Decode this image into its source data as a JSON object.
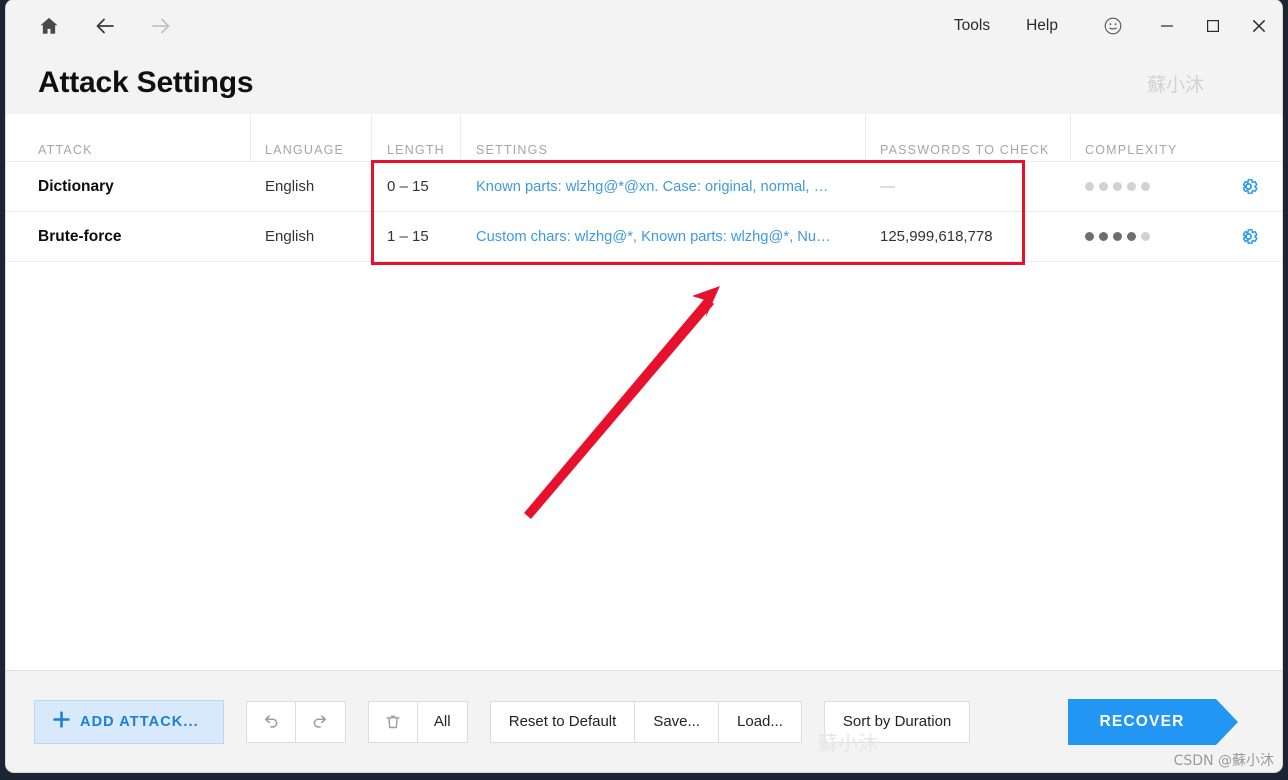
{
  "titlebar": {
    "nav": [
      {
        "name": "home-icon",
        "label": "Home"
      },
      {
        "name": "back-icon",
        "label": "Back"
      },
      {
        "name": "forward-icon",
        "label": "Forward"
      }
    ],
    "menus": [
      {
        "label": "Tools"
      },
      {
        "label": "Help"
      }
    ],
    "smiley_title": "Feedback",
    "window_controls": {
      "minimize": "—",
      "maximize": "□",
      "close": "✕"
    }
  },
  "header": {
    "title": "Attack Settings",
    "watermark": "蘇小沐"
  },
  "table": {
    "columns": [
      {
        "key": "attack",
        "label": "ATTACK"
      },
      {
        "key": "language",
        "label": "LANGUAGE"
      },
      {
        "key": "length",
        "label": "LENGTH"
      },
      {
        "key": "settings",
        "label": "SETTINGS"
      },
      {
        "key": "passwords",
        "label": "PASSWORDS TO CHECK"
      },
      {
        "key": "complexity",
        "label": "COMPLEXITY"
      }
    ],
    "rows": [
      {
        "attack": "Dictionary",
        "language": "English",
        "length": "0 – 15",
        "settings": "Known parts: wlzhg@*@xn. Case: original, normal, …",
        "passwords": "—",
        "passwords_is_dash": true,
        "complexity_filled": 0,
        "complexity_total": 5,
        "gear": "gear-icon"
      },
      {
        "attack": "Brute-force",
        "language": "English",
        "length": "1 – 15",
        "settings": "Custom chars: wlzhg@*, Known parts: wlzhg@*, Nu…",
        "passwords": "125,999,618,778",
        "passwords_is_dash": false,
        "complexity_filled": 4,
        "complexity_total": 5,
        "gear": "gear-icon"
      }
    ]
  },
  "toolbar": {
    "add_attack_label": "ADD ATTACK...",
    "undo_label": "Undo",
    "redo_label": "Redo",
    "delete_label": "Delete",
    "all_label": "All",
    "reset_label": "Reset to Default",
    "save_label": "Save...",
    "load_label": "Load...",
    "sort_label": "Sort by Duration",
    "recover_label": "RECOVER"
  },
  "watermarks": {
    "center": "蘇小沐",
    "csdn": "CSDN @蘇小沐"
  },
  "colors": {
    "accent": "#2196f3",
    "link": "#3d9ae2",
    "annotation": "#e8112d",
    "add_bg": "#d7e9fa"
  }
}
